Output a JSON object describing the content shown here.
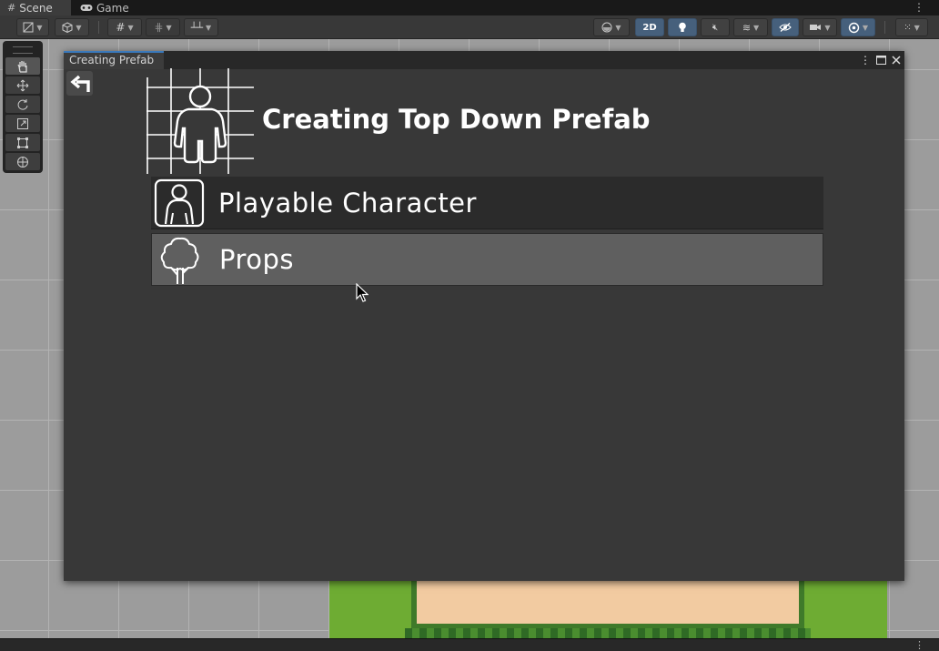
{
  "tabs": [
    {
      "label": "Scene",
      "icon": "grid-hash-icon"
    },
    {
      "label": "Game",
      "icon": "gamepad-icon"
    }
  ],
  "toolbar": {
    "mode_2d_label": "2D"
  },
  "editor_window": {
    "tab_title": "Creating Prefab",
    "title": "Creating Top Down Prefab",
    "menu_items": [
      {
        "label": "Playable Character",
        "icon": "person-outline-icon",
        "state": "normal"
      },
      {
        "label": "Props",
        "icon": "tree-icon",
        "state": "hovered"
      }
    ]
  },
  "colors": {
    "window_bg": "#383838",
    "tab_accent": "#3a79bb",
    "hover_item": "#5f5f5f",
    "scene_grass": "#6eac33",
    "scene_sand": "#f2cba1"
  }
}
